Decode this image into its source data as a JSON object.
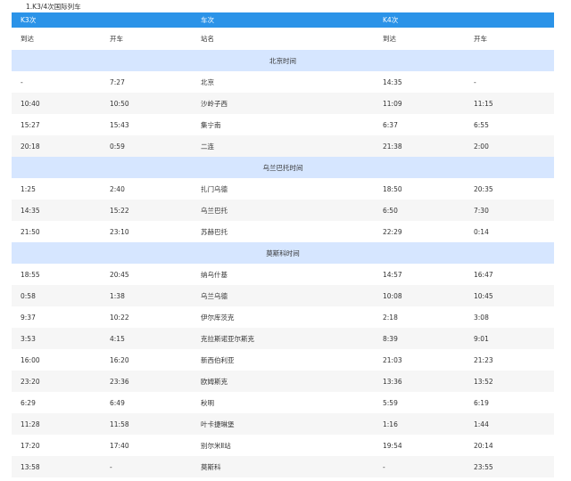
{
  "caption": "1.K3/4次国际列车",
  "header": [
    "K3次",
    "车次",
    "K4次"
  ],
  "subheader": [
    "到达",
    "开车",
    "站名",
    "到达",
    "开车"
  ],
  "sections": [
    {
      "title": "北京时间",
      "rows": [
        [
          "-",
          "7:27",
          "北京",
          "14:35",
          "-"
        ],
        [
          "10:40",
          "10:50",
          "沙岭子西",
          "11:09",
          "11:15"
        ],
        [
          "15:27",
          "15:43",
          "集宁南",
          "6:37",
          "6:55"
        ],
        [
          "20:18",
          "0:59",
          "二连",
          "21:38",
          "2:00"
        ]
      ]
    },
    {
      "title": "乌兰巴托时间",
      "rows": [
        [
          "1:25",
          "2:40",
          "扎门乌德",
          "18:50",
          "20:35"
        ],
        [
          "14:35",
          "15:22",
          "乌兰巴托",
          "6:50",
          "7:30"
        ],
        [
          "21:50",
          "23:10",
          "苏赫巴托",
          "22:29",
          "0:14"
        ]
      ]
    },
    {
      "title": "莫斯科时间",
      "rows": [
        [
          "18:55",
          "20:45",
          "纳乌什基",
          "14:57",
          "16:47"
        ],
        [
          "0:58",
          "1:38",
          "乌兰乌德",
          "10:08",
          "10:45"
        ],
        [
          "9:37",
          "10:22",
          "伊尔库茨克",
          "2:18",
          "3:08"
        ],
        [
          "3:53",
          "4:15",
          "克拉斯诺亚尔斯克",
          "8:39",
          "9:01"
        ],
        [
          "16:00",
          "16:20",
          "新西伯利亚",
          "21:03",
          "21:23"
        ],
        [
          "23:20",
          "23:36",
          "欧姆斯克",
          "13:36",
          "13:52"
        ],
        [
          "6:29",
          "6:49",
          "秋明",
          "5:59",
          "6:19"
        ],
        [
          "11:28",
          "11:58",
          "叶卡捷琳堡",
          "1:16",
          "1:44"
        ],
        [
          "17:20",
          "17:40",
          "别尔米Ⅱ站",
          "19:54",
          "20:14"
        ],
        [
          "13:58",
          "-",
          "莫斯科",
          "-",
          "23:55"
        ]
      ]
    }
  ]
}
